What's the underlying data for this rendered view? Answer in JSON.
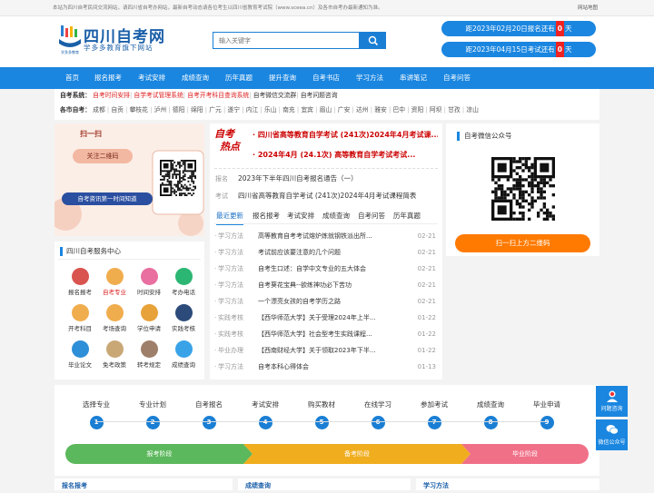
{
  "topbar": {
    "notice": "本站为四川自考民间交流网站，请四川省自考办网站，最新自考动态请各位考生以四川省教育考试院（www.sceea.cn）及各市自考办最新通知为准。",
    "sitemap": "网站地图"
  },
  "logo": {
    "title": "四川自考网",
    "subtitle": "学多多教育旗下网站",
    "mark_text": "学多多教育"
  },
  "search": {
    "placeholder": "输入关键字"
  },
  "countdown": [
    {
      "prefix": "距2023年02月20日报名还有",
      "value": "0",
      "suffix": "天"
    },
    {
      "prefix": "距2023年04月15日考试还有",
      "value": "0",
      "suffix": "天"
    }
  ],
  "nav": [
    "首页",
    "报名报考",
    "考试安排",
    "成绩查询",
    "历年真题",
    "提升查询",
    "自考书店",
    "学习方法",
    "串讲笔记",
    "自考问答"
  ],
  "links": {
    "label1": "自考系统：",
    "items1": [
      "自考时间安排",
      "自学考试管理系统",
      "自考开考科目查询系统",
      "自考微信交流群",
      "自考问题咨询"
    ],
    "label2": "各市自考：",
    "cities": [
      "成都",
      "自贡",
      "攀枝花",
      "泸州",
      "德阳",
      "绵阳",
      "广元",
      "遂宁",
      "内江",
      "乐山",
      "南充",
      "宜宾",
      "眉山",
      "广安",
      "达州",
      "雅安",
      "巴中",
      "资阳",
      "阿坝",
      "甘孜",
      "凉山"
    ]
  },
  "banner": {
    "line1": "扫一扫",
    "line2": "关注二维码",
    "line3": "自考资讯第一时间知道"
  },
  "service": {
    "title": "四川自考服务中心",
    "items": [
      "报名报考",
      "自考专业",
      "时间安排",
      "考办电话",
      "开考科目",
      "考场查询",
      "学位申请",
      "实践考核",
      "毕业论文",
      "免考政策",
      "转考规定",
      "成绩查询"
    ],
    "colors": [
      "#d9534f",
      "#f0ad4e",
      "#e86fa0",
      "#2bb673",
      "#f0ad4e",
      "#f0ad4e",
      "#e8a23a",
      "#2d4b7a",
      "#2d8fd8",
      "#c9a876",
      "#9e7f6a",
      "#3aa3e8"
    ]
  },
  "hot": {
    "badge1": "自考",
    "badge2": "热点",
    "headlines": [
      "四川省高等教育自学考试 (241次)2024年4月考试课...",
      "2024年4月 (24.1次) 高等教育自学考试考试..."
    ]
  },
  "notices": [
    {
      "label": "报名",
      "text": "2023年下半年四川自考报名通告（一）"
    },
    {
      "label": "考试",
      "text": "四川省高等教育自学考试 (241次)2024年4月考试课程简表"
    }
  ],
  "tabs": [
    "最近更新",
    "报名报考",
    "考试安排",
    "成绩查询",
    "自考问答",
    "历年真题"
  ],
  "list": [
    {
      "cat": "学习方法",
      "title": "高等教育自考考试熔炉炼就钢铁派出所...",
      "date": "02-21"
    },
    {
      "cat": "学习方法",
      "title": "考试前应该要注意的几个问题",
      "date": "02-21"
    },
    {
      "cat": "学习方法",
      "title": "自考生口述：自学中文专业的五大体会",
      "date": "02-21"
    },
    {
      "cat": "学习方法",
      "title": "自考葵花宝典--欲练神功必下苦功",
      "date": "02-21"
    },
    {
      "cat": "学习方法",
      "title": "一个漂亮女孩的自考学历之路",
      "date": "02-21"
    },
    {
      "cat": "实践考核",
      "title": "【西华师范大学】关于受理2024年上半...",
      "date": "01-22"
    },
    {
      "cat": "实践考核",
      "title": "【西华师范大学】社会型考生实践课程...",
      "date": "01-22"
    },
    {
      "cat": "毕业办理",
      "title": "【西南财经大学】关于领取2023年下半...",
      "date": "01-22"
    },
    {
      "cat": "学习方法",
      "title": "自考本科心得体会",
      "date": "01-13"
    }
  ],
  "wechat": {
    "title": "自考微信公众号",
    "button": "扫一扫上方二维码"
  },
  "steps": [
    "选择专业",
    "专业计划",
    "自考报名",
    "考试安排",
    "购买教材",
    "在线学习",
    "参加考试",
    "成绩查询",
    "毕业申请"
  ],
  "stages": [
    "报考阶段",
    "备考阶段",
    "毕业阶段"
  ],
  "float": [
    "问题咨询",
    "微信公众号"
  ],
  "bottom": [
    "报名报考",
    "成绩查询",
    "学习方法"
  ]
}
